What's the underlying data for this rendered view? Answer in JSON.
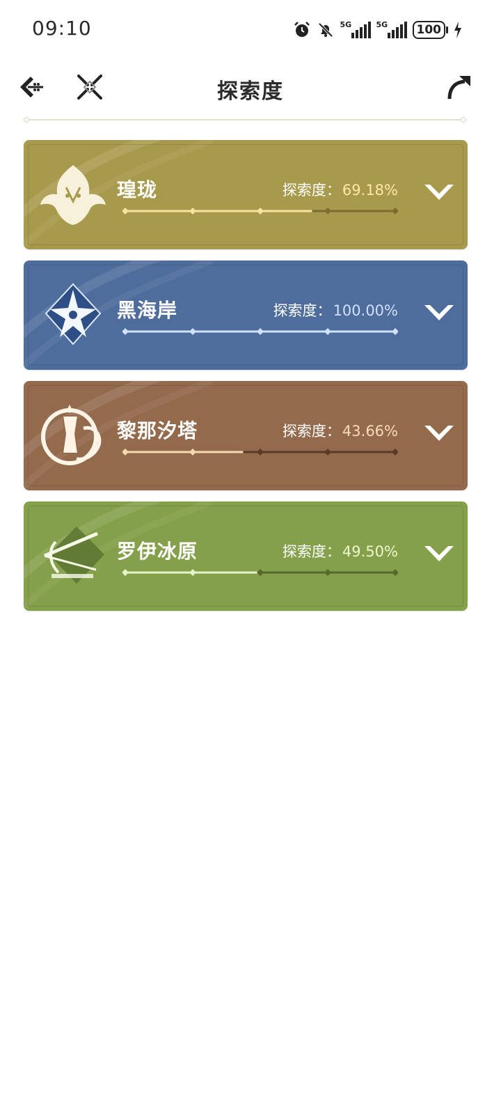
{
  "status_bar": {
    "time": "09:10",
    "signal1_label": "5G",
    "signal2_label": "5G",
    "battery": "100"
  },
  "header": {
    "title": "探索度"
  },
  "regions": [
    {
      "name": "瑝珑",
      "label": "探索度：",
      "percent": "69.18%",
      "progress": 0.6918,
      "card_color": "#a89a4c",
      "fill_color": "#f3e2a0",
      "track_color": "#7c6c32",
      "value_color": "#fbe7a6",
      "emblem_icon": "dragon-emblem-icon"
    },
    {
      "name": "黑海岸",
      "label": "探索度：",
      "percent": "100.00%",
      "progress": 1.0,
      "card_color": "#4f6d9c",
      "fill_color": "#cfe2ff",
      "track_color": "#2f4a78",
      "value_color": "#cfe0ff",
      "emblem_icon": "star-flower-emblem-icon"
    },
    {
      "name": "黎那汐塔",
      "label": "探索度：",
      "percent": "43.66%",
      "progress": 0.4366,
      "card_color": "#946a4d",
      "fill_color": "#f6d9b0",
      "track_color": "#5a3a26",
      "value_color": "#f8dcb8",
      "emblem_icon": "hourglass-emblem-icon"
    },
    {
      "name": "罗伊冰原",
      "label": "探索度：",
      "percent": "49.50%",
      "progress": 0.495,
      "card_color": "#85a04a",
      "fill_color": "#e6f2c7",
      "track_color": "#55692a",
      "value_color": "#eef6cf",
      "emblem_icon": "arrow-emblem-icon"
    }
  ]
}
